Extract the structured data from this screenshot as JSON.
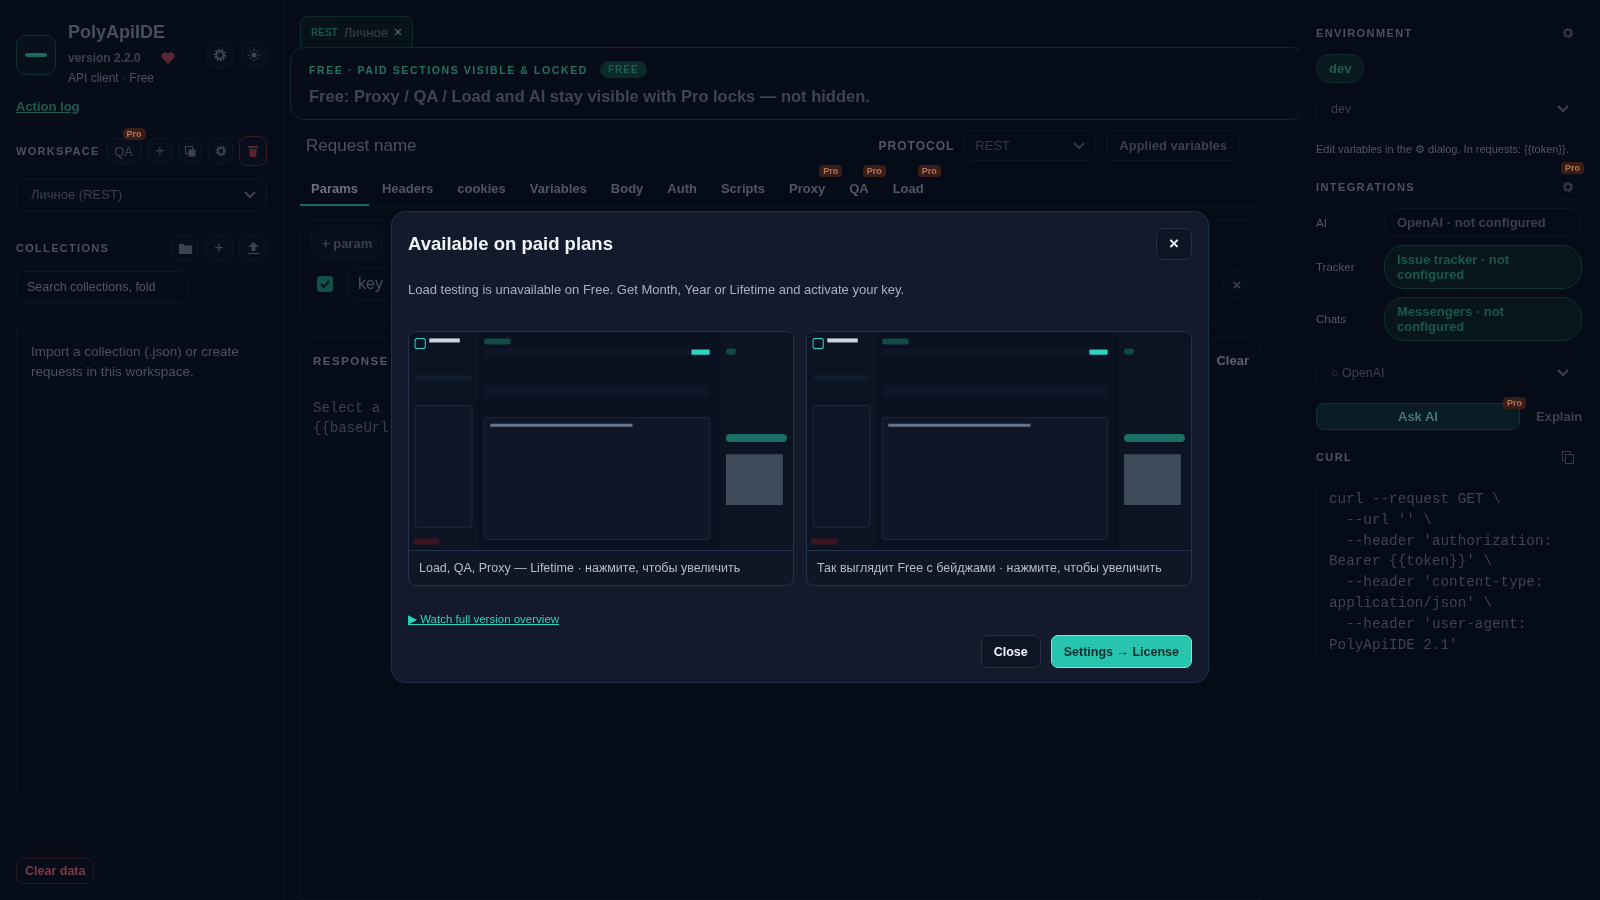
{
  "sidebar": {
    "app_name": "PolyApiIDE",
    "version": "version 2.2.0",
    "subtitle": "API client · Free",
    "action_log": "Action log",
    "workspace": {
      "label": "WORKSPACE",
      "qa_button": "QA",
      "qa_badge": "Pro",
      "add": "+",
      "selected": "Личное (REST)"
    },
    "collections": {
      "label": "COLLECTIONS",
      "add": "+",
      "search_placeholder": "Search collections, fold",
      "empty": "Import a collection (.json) or create requests in this workspace."
    },
    "clear_data": "Clear data"
  },
  "request_tabs": [
    {
      "method": "REST",
      "name": "Личное",
      "close": "×",
      "selected": true
    }
  ],
  "banner": {
    "eyebrow": "FREE · PAID SECTIONS VISIBLE & LOCKED",
    "badge": "FREE",
    "text": "Free: Proxy / QA / Load and AI stay visible with Pro locks — not hidden."
  },
  "request": {
    "name_placeholder": "Request name",
    "protocol_label": "PROTOCOL",
    "protocol": "REST",
    "applied_variables": "Applied variables"
  },
  "section_tabs": [
    {
      "label": "Params",
      "selected": true
    },
    {
      "label": "Headers",
      "selected": false
    },
    {
      "label": "cookies",
      "selected": false
    },
    {
      "label": "Variables",
      "selected": false
    },
    {
      "label": "Body",
      "selected": false
    },
    {
      "label": "Auth",
      "selected": false
    },
    {
      "label": "Scripts",
      "selected": false
    },
    {
      "label": "Proxy",
      "selected": false,
      "badge": "Pro"
    },
    {
      "label": "QA",
      "selected": false,
      "badge": "Pro"
    },
    {
      "label": "Load",
      "selected": false,
      "badge": "Pro"
    }
  ],
  "params": {
    "add": "+ param",
    "rows": [
      {
        "checked": true,
        "key_placeholder": "key",
        "remove": "×"
      }
    ]
  },
  "response": {
    "label": "RESPONSE",
    "clear": "Clear",
    "hint": [
      "Select a",
      "{{baseUrl"
    ]
  },
  "right_panel": {
    "environment": {
      "label": "ENVIRONMENT",
      "chip": "dev",
      "selected": "dev",
      "hint": "Edit variables in the ⚙ dialog. In requests: {{token}}."
    },
    "integrations": {
      "label": "INTEGRATIONS",
      "badge": "Pro",
      "rows": [
        {
          "label": "AI",
          "value": "OpenAI · not configured",
          "kind": "plain"
        },
        {
          "label": "Tracker",
          "value": "Issue tracker · not configured",
          "kind": "accent"
        },
        {
          "label": "Chats",
          "value": "Messengers · not configured",
          "kind": "accent"
        }
      ]
    },
    "provider": "○ OpenAI",
    "ask_ai": "Ask AI",
    "ask_badge": "Pro",
    "explain": "Explain",
    "curl": {
      "label": "CURL",
      "lines": [
        "curl --request GET \\",
        "  --url '' \\",
        "  --header 'authorization:",
        "Bearer {{token}}' \\",
        "  --header 'content-type:",
        "application/json' \\",
        "  --header 'user-agent:",
        "PolyApiIDE 2.1'"
      ]
    }
  },
  "modal": {
    "title": "Available on paid plans",
    "close": "×",
    "text": "Load testing is unavailable on Free. Get Month, Year or Lifetime and activate your key.",
    "previews": [
      {
        "caption": "Load, QA, Proxy — Lifetime · нажмите, чтобы увеличить"
      },
      {
        "caption": "Так выглядит Free с бейджами · нажмите, чтобы увеличить"
      }
    ],
    "link": "▶ Watch full version overview",
    "buttons": [
      {
        "label": "Close",
        "kind": "secondary"
      },
      {
        "label": "Settings → License",
        "kind": "primary"
      }
    ]
  }
}
